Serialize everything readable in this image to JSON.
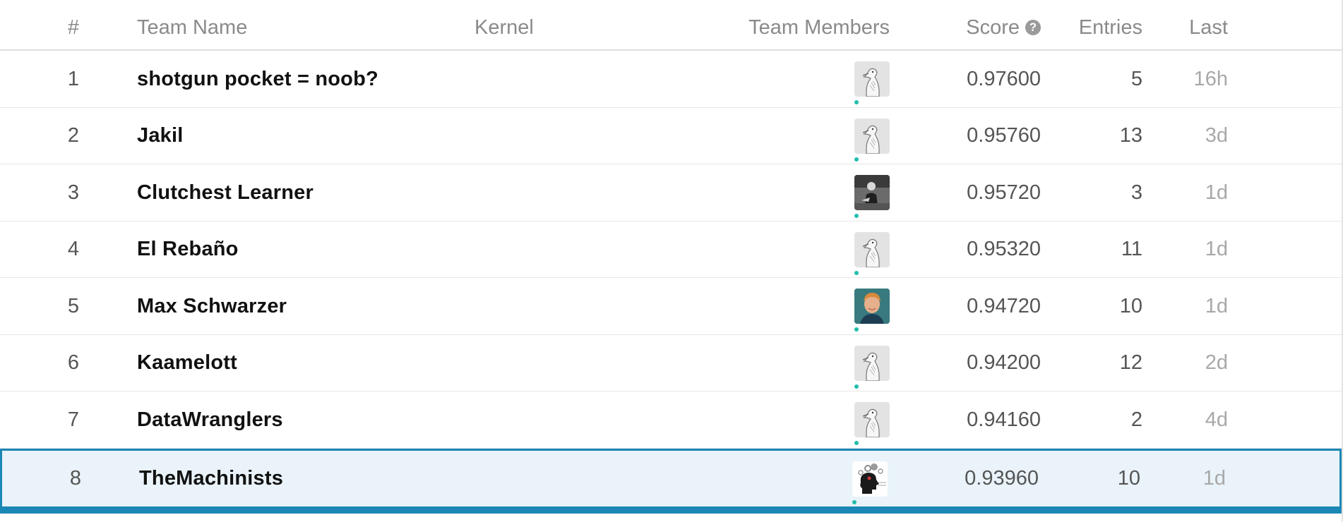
{
  "header": {
    "rank": "#",
    "team_name": "Team Name",
    "kernel": "Kernel",
    "team_members": "Team Members",
    "score": "Score",
    "score_help": "?",
    "entries": "Entries",
    "last": "Last"
  },
  "colors": {
    "highlight_background": "#e9f3f9",
    "highlight_border": "#1b87b5",
    "online_dot": "#20beac"
  },
  "rows": [
    {
      "rank": "1",
      "team": "shotgun pocket = noob?",
      "avatar": "goose-avatar-icon",
      "score": "0.97600",
      "entries": "5",
      "last": "16h"
    },
    {
      "rank": "2",
      "team": "Jakil",
      "avatar": "goose-avatar-icon",
      "score": "0.95760",
      "entries": "13",
      "last": "3d"
    },
    {
      "rank": "3",
      "team": "Clutchest Learner",
      "avatar": "photo-avatar-icon",
      "score": "0.95720",
      "entries": "3",
      "last": "1d"
    },
    {
      "rank": "4",
      "team": "El Rebaño",
      "avatar": "goose-avatar-icon",
      "score": "0.95320",
      "entries": "11",
      "last": "1d"
    },
    {
      "rank": "5",
      "team": "Max Schwarzer",
      "avatar": "portrait-avatar-icon",
      "score": "0.94720",
      "entries": "10",
      "last": "1d"
    },
    {
      "rank": "6",
      "team": "Kaamelott",
      "avatar": "goose-avatar-icon",
      "score": "0.94200",
      "entries": "12",
      "last": "2d"
    },
    {
      "rank": "7",
      "team": "DataWranglers",
      "avatar": "goose-avatar-icon",
      "score": "0.94160",
      "entries": "2",
      "last": "4d"
    },
    {
      "rank": "8",
      "team": "TheMachinists",
      "avatar": "head-gears-avatar-icon",
      "score": "0.93960",
      "entries": "10",
      "last": "1d",
      "highlighted": true
    }
  ]
}
